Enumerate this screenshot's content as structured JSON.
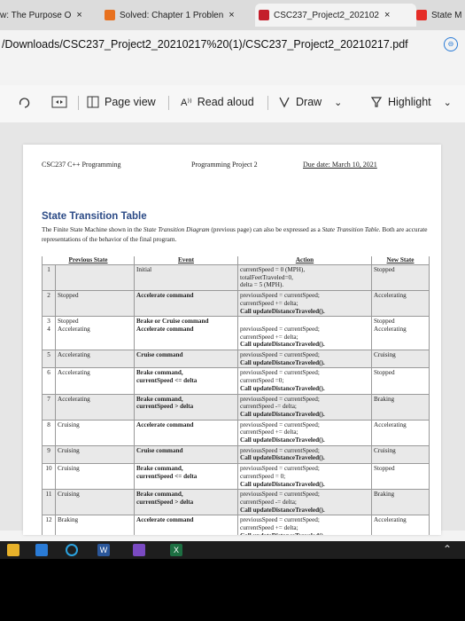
{
  "tabs": [
    {
      "label": "w: The Purpose O",
      "icon": "browser-tab-icon",
      "close": "×",
      "color": "#cfcfcf"
    },
    {
      "label": "Solved: Chapter 1 Problen",
      "icon": "chegg-icon",
      "close": "×",
      "color": "#e8711f"
    },
    {
      "label": "CSC237_Project2_202102",
      "icon": "pdf-icon",
      "close": "×",
      "color": "#c41e2b"
    },
    {
      "label": "State M",
      "icon": "youtube-icon",
      "close": "",
      "color": "#e52d27"
    }
  ],
  "address": {
    "url": "/Downloads/CSC237_Project2_20210217%20(1)/CSC237_Project2_20210217.pdf",
    "zoom_icon": "⊖"
  },
  "toolbar": {
    "page_view": "Page view",
    "read_aloud": "Read aloud",
    "draw": "Draw",
    "highlight": "Highlight",
    "read_glyph": "A⁾⁾",
    "chevron": "⌄"
  },
  "page": {
    "header_left": "CSC237 C++ Programming",
    "header_center": "Programming Project 2",
    "header_right": "Due date: March 10, 2021",
    "title": "State Transition Table",
    "intro_1": "The Finite State Machine shown in the ",
    "intro_diagram": "State Transition Diagram",
    "intro_2": " (previous page) can also be expressed as a ",
    "intro_table": "State Transition Table",
    "intro_3": ". Both are accurate representations of the behavior of the final program.",
    "columns": [
      "Previous State",
      "Event",
      "Action",
      "New State"
    ],
    "rows": [
      {
        "num": "1",
        "prev": "",
        "event": "Initial",
        "bold_event": false,
        "action": [
          "currentSpeed = 0 (MPH),",
          "totalFeetTraveled=0,",
          "delta = 5 (MPH)."
        ],
        "bold_last": false,
        "new": "Stopped"
      },
      {
        "num": "2",
        "prev": "Stopped",
        "event": "Accelerate command",
        "bold_event": true,
        "action": [
          "previousSpeed = currentSpeed;",
          "currentSpeed += delta;",
          "Call updateDistanceTraveled()."
        ],
        "bold_last": true,
        "new": "Accelerating"
      },
      {
        "num": "3\n4",
        "prev": "Stopped\nAccelerating",
        "event": "Brake or Cruise command\nAccelerate command",
        "bold_event": true,
        "action": [
          "",
          "previousSpeed = currentSpeed;",
          "currentSpeed += delta;",
          "Call updateDistanceTraveled()."
        ],
        "bold_last": true,
        "new": "Stopped\nAccelerating"
      },
      {
        "num": "5",
        "prev": "Accelerating",
        "event": "Cruise command",
        "bold_event": true,
        "action": [
          "previousSpeed = currentSpeed;",
          "Call updateDistanceTraveled()."
        ],
        "bold_last": true,
        "new": "Cruising"
      },
      {
        "num": "6",
        "prev": "Accelerating",
        "event": "Brake command,\ncurrentSpeed <= delta",
        "bold_event": true,
        "action": [
          "previousSpeed = currentSpeed;",
          "currentSpeed =0;",
          "Call updateDistanceTraveled()."
        ],
        "bold_last": true,
        "new": "Stopped"
      },
      {
        "num": "7",
        "prev": "Accelerating",
        "event": "Brake command,\ncurrentSpeed > delta",
        "bold_event": true,
        "action": [
          "previousSpeed = currentSpeed;",
          "currentSpeed -= delta;",
          "Call updateDistanceTraveled()."
        ],
        "bold_last": true,
        "new": "Braking"
      },
      {
        "num": "8",
        "prev": "Cruising",
        "event": "Accelerate command",
        "bold_event": true,
        "action": [
          "previousSpeed = currentSpeed;",
          "currentSpeed += delta;",
          "Call updateDistanceTraveled()."
        ],
        "bold_last": true,
        "new": "Accelerating"
      },
      {
        "num": "9",
        "prev": "Cruising",
        "event": "Cruise command",
        "bold_event": true,
        "action": [
          "previousSpeed = currentSpeed;",
          "Call updateDistanceTraveled()."
        ],
        "bold_last": true,
        "new": "Cruising"
      },
      {
        "num": "10",
        "prev": "Cruising",
        "event": "Brake command,\ncurrentSpeed <= delta",
        "bold_event": true,
        "action": [
          "previousSpeed = currentSpeed;",
          "currentSpeed = 0;",
          "Call updateDistanceTraveled()."
        ],
        "bold_last": true,
        "new": "Stopped"
      },
      {
        "num": "11",
        "prev": "Cruising",
        "event": "Brake command,\ncurrentSpeed > delta",
        "bold_event": true,
        "action": [
          "previousSpeed = currentSpeed;",
          "currentSpeed -= delta;",
          "Call updateDistanceTraveled()."
        ],
        "bold_last": true,
        "new": "Braking"
      },
      {
        "num": "12",
        "prev": "Braking",
        "event": "Accelerate command",
        "bold_event": true,
        "action": [
          "previousSpeed = currentSpeed;",
          "currentSpeed += delta;",
          "Call updateDistanceTraveled()."
        ],
        "bold_last": true,
        "new": "Accelerating"
      }
    ]
  },
  "taskbar": {
    "word_label": "W",
    "excel_label": "X"
  }
}
